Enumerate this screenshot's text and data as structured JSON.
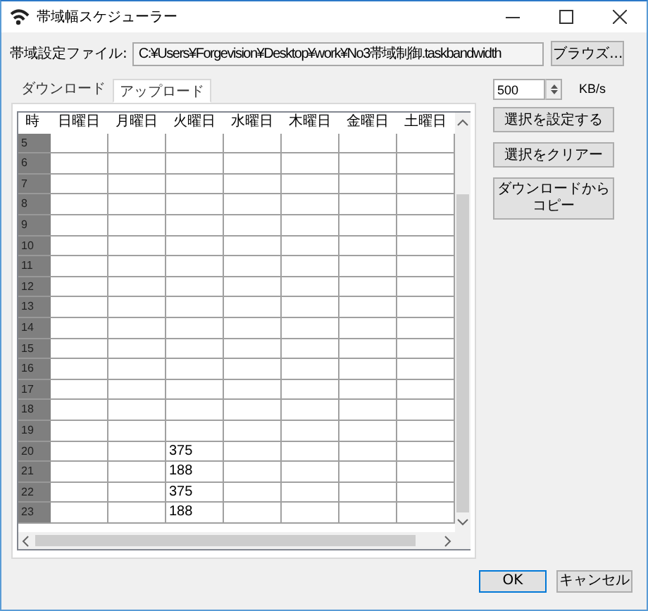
{
  "window": {
    "title": "帯域幅スケジューラー"
  },
  "file": {
    "label": "帯域設定ファイル:",
    "value": "C:¥Users¥Forgevision¥Desktop¥work¥No3帯域制御.taskbandwidth",
    "browse": "ブラウズ..."
  },
  "tabs": [
    {
      "label": "ダウンロード",
      "selected": false
    },
    {
      "label": "アップロード",
      "selected": true
    }
  ],
  "table": {
    "columns": [
      "時",
      "日曜日",
      "月曜日",
      "火曜日",
      "水曜日",
      "木曜日",
      "金曜日",
      "土曜日"
    ],
    "rows": [
      {
        "hour": "5"
      },
      {
        "hour": "6"
      },
      {
        "hour": "7"
      },
      {
        "hour": "8"
      },
      {
        "hour": "9"
      },
      {
        "hour": "10"
      },
      {
        "hour": "11"
      },
      {
        "hour": "12"
      },
      {
        "hour": "13"
      },
      {
        "hour": "14"
      },
      {
        "hour": "15"
      },
      {
        "hour": "16"
      },
      {
        "hour": "17"
      },
      {
        "hour": "18"
      },
      {
        "hour": "19"
      },
      {
        "hour": "20",
        "col_3": "375"
      },
      {
        "hour": "21",
        "col_3": "188"
      },
      {
        "hour": "22",
        "col_3": "375"
      },
      {
        "hour": "23",
        "col_3": "188"
      }
    ]
  },
  "rate": {
    "value": "500",
    "unit": "KB/s"
  },
  "actions": [
    "選択を設定する",
    "選択をクリアー",
    "ダウンロードからコピー"
  ],
  "buttons": [
    "OK",
    "キャンセル"
  ]
}
